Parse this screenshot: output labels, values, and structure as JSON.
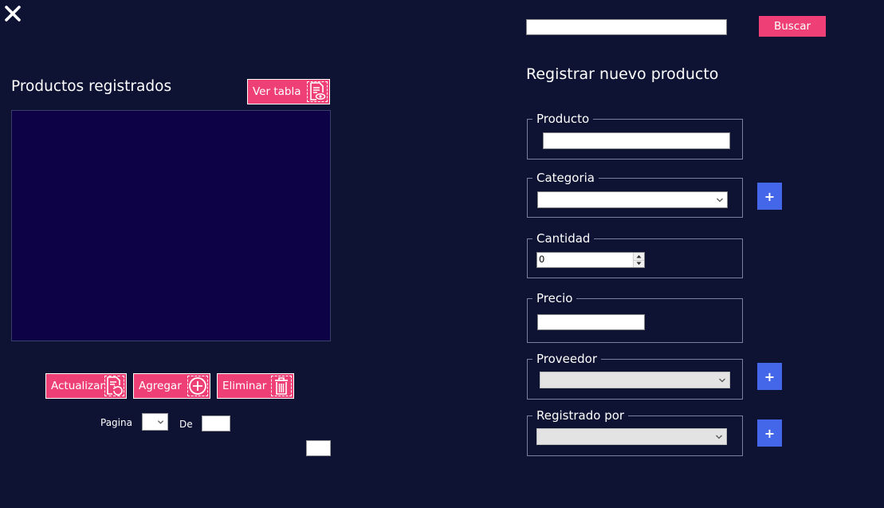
{
  "window": {
    "close_icon": "close-icon"
  },
  "left": {
    "title": "Productos registrados",
    "view_table_label": "Ver tabla",
    "actions": {
      "refresh_label": "Actualizar",
      "add_label": "Agregar",
      "delete_label": "Eliminar"
    },
    "pagination": {
      "page_label": "Pagina",
      "of_label": "De",
      "page_value": "",
      "total_value": ""
    }
  },
  "right": {
    "search": {
      "value": "",
      "button_label": "Buscar"
    },
    "form_title": "Registrar nuevo producto",
    "fields": {
      "producto": {
        "legend": "Producto",
        "value": ""
      },
      "categoria": {
        "legend": "Categoria",
        "value": ""
      },
      "cantidad": {
        "legend": "Cantidad",
        "value": "0"
      },
      "precio": {
        "legend": "Precio",
        "value": ""
      },
      "proveedor": {
        "legend": "Proveedor",
        "value": ""
      },
      "registrado_por": {
        "legend": "Registrado por",
        "value": ""
      }
    },
    "add_symbol": "+"
  },
  "colors": {
    "background": "#0e1334",
    "grid": "#0e0246",
    "accent_pink": "#ee4077",
    "accent_blue": "#4466e8"
  }
}
